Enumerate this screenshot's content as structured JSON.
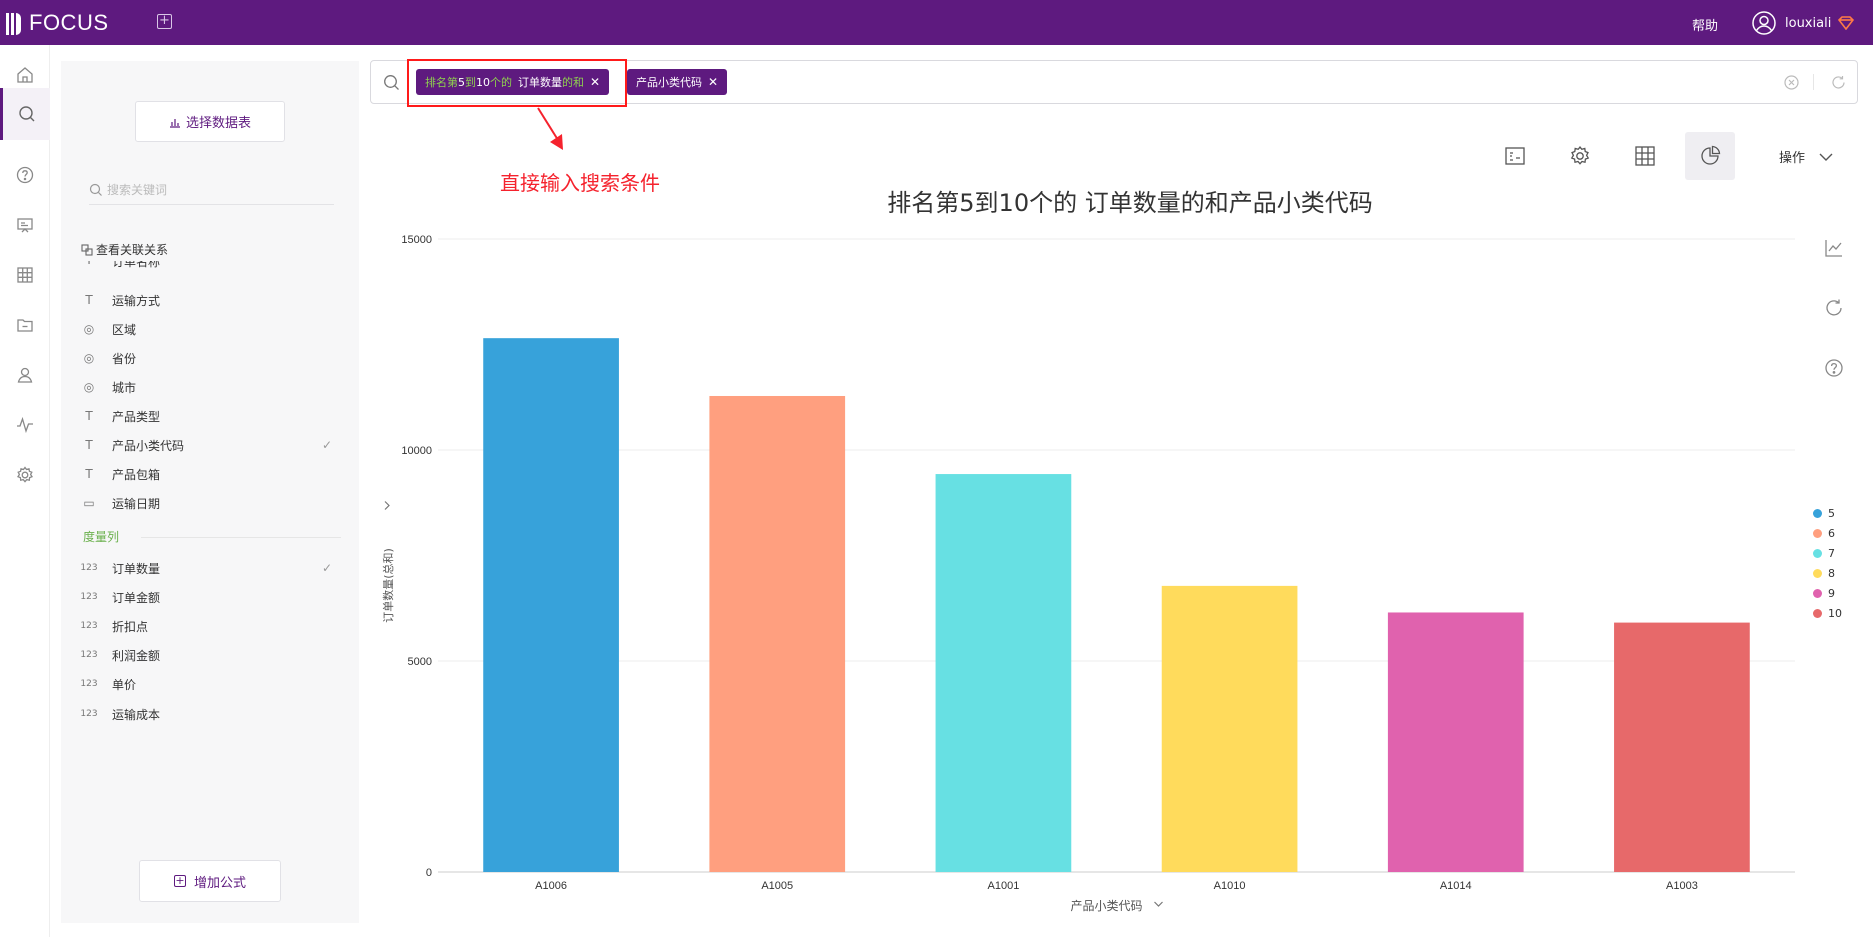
{
  "topbar": {
    "logo_text": "FOCUS",
    "help_label": "帮助",
    "username": "louxiali",
    "brand_color": "#5e1a7f"
  },
  "rail": {
    "icons": [
      "home-icon",
      "search-icon",
      "help-icon",
      "presentation-icon",
      "table-icon",
      "folder-icon",
      "user-icon",
      "activity-icon",
      "settings-icon"
    ],
    "active": "search-icon"
  },
  "panel": {
    "select_table_label": "选择数据表",
    "search_placeholder": "搜索关键词",
    "relation_label": "查看关联关系",
    "partial_field": "订单名称",
    "dimension_fields": [
      {
        "name": "运输方式",
        "type": "text",
        "checked": false
      },
      {
        "name": "区域",
        "type": "geo",
        "checked": false
      },
      {
        "name": "省份",
        "type": "geo",
        "checked": false
      },
      {
        "name": "城市",
        "type": "geo",
        "checked": false
      },
      {
        "name": "产品类型",
        "type": "text",
        "checked": false
      },
      {
        "name": "产品小类代码",
        "type": "text",
        "checked": true
      },
      {
        "name": "产品包箱",
        "type": "text",
        "checked": false
      },
      {
        "name": "运输日期",
        "type": "date",
        "checked": false
      }
    ],
    "measure_section_title": "度量列",
    "measure_fields": [
      {
        "name": "订单数量",
        "type": "number",
        "checked": true
      },
      {
        "name": "订单金额",
        "type": "number",
        "checked": false
      },
      {
        "name": "折扣点",
        "type": "number",
        "checked": false
      },
      {
        "name": "利润金额",
        "type": "number",
        "checked": false
      },
      {
        "name": "单价",
        "type": "number",
        "checked": false
      },
      {
        "name": "运输成本",
        "type": "number",
        "checked": false
      }
    ],
    "add_formula_label": "增加公式"
  },
  "search": {
    "token1_part1": "排名第",
    "token1_part2": "5",
    "token1_part3": "到",
    "token1_part4": "10",
    "token1_part5": "个的",
    "token1_part6": "订单数量",
    "token1_part7": "的和",
    "token2": "产品小类代码"
  },
  "annotation": {
    "text": "直接输入搜索条件",
    "color": "#f5222d"
  },
  "toolbar": {
    "ops_label": "操作",
    "icons": [
      "chart-type-icon",
      "gear-icon",
      "table-view-icon",
      "chart-view-icon"
    ]
  },
  "chart_title": "排名第5到10个的 订单数量的和产品小类代码",
  "chart_data": {
    "type": "bar",
    "title": "排名第5到10个的 订单数量的和产品小类代码",
    "xlabel": "产品小类代码",
    "ylabel": "订单数量(总和)",
    "categories": [
      "A1006",
      "A1005",
      "A1001",
      "A1010",
      "A1014",
      "A1003"
    ],
    "values": [
      12650,
      11280,
      9430,
      6780,
      6150,
      5910
    ],
    "ylim": [
      0,
      15000
    ],
    "yticks": [
      0,
      5000,
      10000,
      15000
    ],
    "colors": [
      "#37a2da",
      "#ff9f7f",
      "#67e0e3",
      "#ffdb5c",
      "#e062ae",
      "#e7696a"
    ],
    "legend": [
      "5",
      "6",
      "7",
      "8",
      "9",
      "10"
    ],
    "legend_position": "right",
    "grid": true
  }
}
